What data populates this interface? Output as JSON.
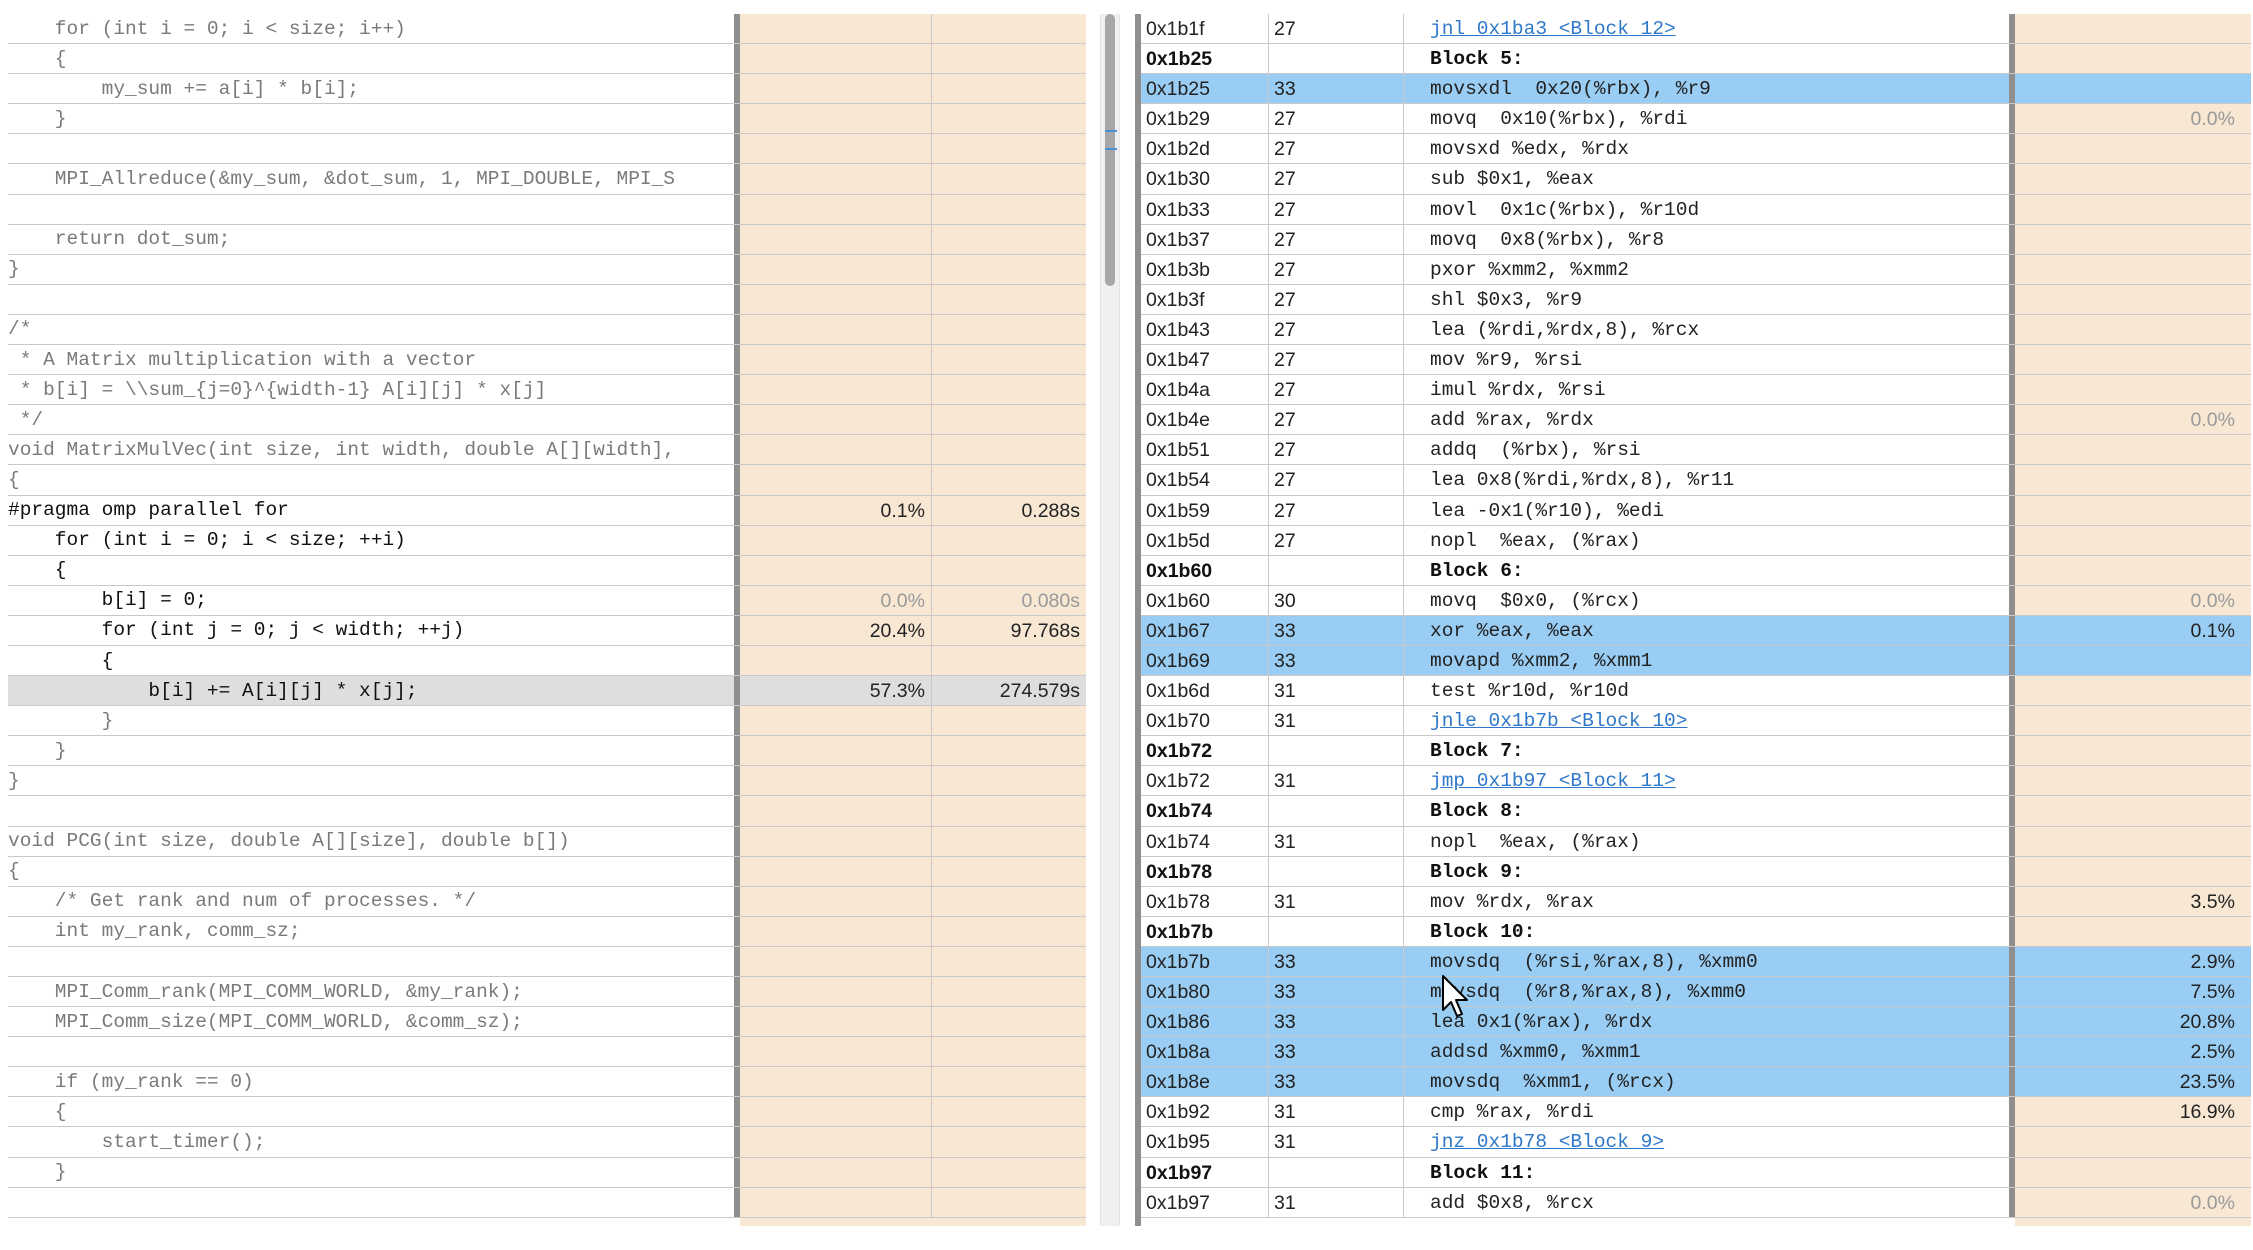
{
  "source": {
    "rows": [
      {
        "code": "    for (int i = 0; i < size; i++)",
        "pct": "",
        "time": ""
      },
      {
        "code": "    {",
        "pct": "",
        "time": ""
      },
      {
        "code": "        my_sum += a[i] * b[i];",
        "pct": "",
        "time": ""
      },
      {
        "code": "    }",
        "pct": "",
        "time": ""
      },
      {
        "code": "",
        "pct": "",
        "time": ""
      },
      {
        "code": "    MPI_Allreduce(&my_sum, &dot_sum, 1, MPI_DOUBLE, MPI_S",
        "pct": "",
        "time": ""
      },
      {
        "code": "",
        "pct": "",
        "time": ""
      },
      {
        "code": "    return dot_sum;",
        "pct": "",
        "time": ""
      },
      {
        "code": "}",
        "pct": "",
        "time": ""
      },
      {
        "code": "",
        "pct": "",
        "time": ""
      },
      {
        "code": "/*",
        "pct": "",
        "time": ""
      },
      {
        "code": " * A Matrix multiplication with a vector",
        "pct": "",
        "time": ""
      },
      {
        "code": " * b[i] = \\\\sum_{j=0}^{width-1} A[i][j] * x[j]",
        "pct": "",
        "time": ""
      },
      {
        "code": " */",
        "pct": "",
        "time": ""
      },
      {
        "code": "void MatrixMulVec(int size, int width, double A[][width],",
        "pct": "",
        "time": ""
      },
      {
        "code": "{",
        "pct": "",
        "time": ""
      },
      {
        "code": "#pragma omp parallel for",
        "pct": "0.1%",
        "time": "0.288s",
        "hot": true
      },
      {
        "code": "    for (int i = 0; i < size; ++i)",
        "pct": "",
        "time": "",
        "hot": true
      },
      {
        "code": "    {",
        "pct": "",
        "time": "",
        "hot": true
      },
      {
        "code": "        b[i] = 0;",
        "pct": "0.0%",
        "time": "0.080s",
        "hot": true,
        "muted": true
      },
      {
        "code": "        for (int j = 0; j < width; ++j)",
        "pct": "20.4%",
        "time": "97.768s",
        "hot": true
      },
      {
        "code": "        {",
        "pct": "",
        "time": "",
        "hot": true
      },
      {
        "code": "            b[i] += A[i][j] * x[j];",
        "pct": "57.3%",
        "time": "274.579s",
        "hot": true,
        "highlight": true
      },
      {
        "code": "        }",
        "pct": "",
        "time": ""
      },
      {
        "code": "    }",
        "pct": "",
        "time": ""
      },
      {
        "code": "}",
        "pct": "",
        "time": ""
      },
      {
        "code": "",
        "pct": "",
        "time": ""
      },
      {
        "code": "void PCG(int size, double A[][size], double b[])",
        "pct": "",
        "time": ""
      },
      {
        "code": "{",
        "pct": "",
        "time": ""
      },
      {
        "code": "    /* Get rank and num of processes. */",
        "pct": "",
        "time": ""
      },
      {
        "code": "    int my_rank, comm_sz;",
        "pct": "",
        "time": ""
      },
      {
        "code": "",
        "pct": "",
        "time": ""
      },
      {
        "code": "    MPI_Comm_rank(MPI_COMM_WORLD, &my_rank);",
        "pct": "",
        "time": ""
      },
      {
        "code": "    MPI_Comm_size(MPI_COMM_WORLD, &comm_sz);",
        "pct": "",
        "time": ""
      },
      {
        "code": "",
        "pct": "",
        "time": ""
      },
      {
        "code": "    if (my_rank == 0)",
        "pct": "",
        "time": ""
      },
      {
        "code": "    {",
        "pct": "",
        "time": ""
      },
      {
        "code": "        start_timer();",
        "pct": "",
        "time": ""
      },
      {
        "code": "    }",
        "pct": "",
        "time": ""
      },
      {
        "code": "",
        "pct": "",
        "time": ""
      }
    ]
  },
  "assembly": {
    "rows": [
      {
        "addr": "0x1b1f",
        "line": "27",
        "instr": "jnl 0x1ba3 <Block 12>",
        "pct": "",
        "link": true
      },
      {
        "addr": "0x1b25",
        "line": "",
        "instr": "Block 5:",
        "pct": "",
        "block": true
      },
      {
        "addr": "0x1b25",
        "line": "33",
        "instr": "movsxdl  0x20(%rbx), %r9",
        "pct": "",
        "selected": true
      },
      {
        "addr": "0x1b29",
        "line": "27",
        "instr": "movq  0x10(%rbx), %rdi",
        "pct": "0.0%",
        "muted": true
      },
      {
        "addr": "0x1b2d",
        "line": "27",
        "instr": "movsxd %edx, %rdx",
        "pct": ""
      },
      {
        "addr": "0x1b30",
        "line": "27",
        "instr": "sub $0x1, %eax",
        "pct": ""
      },
      {
        "addr": "0x1b33",
        "line": "27",
        "instr": "movl  0x1c(%rbx), %r10d",
        "pct": ""
      },
      {
        "addr": "0x1b37",
        "line": "27",
        "instr": "movq  0x8(%rbx), %r8",
        "pct": ""
      },
      {
        "addr": "0x1b3b",
        "line": "27",
        "instr": "pxor %xmm2, %xmm2",
        "pct": ""
      },
      {
        "addr": "0x1b3f",
        "line": "27",
        "instr": "shl $0x3, %r9",
        "pct": ""
      },
      {
        "addr": "0x1b43",
        "line": "27",
        "instr": "lea (%rdi,%rdx,8), %rcx",
        "pct": ""
      },
      {
        "addr": "0x1b47",
        "line": "27",
        "instr": "mov %r9, %rsi",
        "pct": ""
      },
      {
        "addr": "0x1b4a",
        "line": "27",
        "instr": "imul %rdx, %rsi",
        "pct": ""
      },
      {
        "addr": "0x1b4e",
        "line": "27",
        "instr": "add %rax, %rdx",
        "pct": "0.0%",
        "muted": true
      },
      {
        "addr": "0x1b51",
        "line": "27",
        "instr": "addq  (%rbx), %rsi",
        "pct": ""
      },
      {
        "addr": "0x1b54",
        "line": "27",
        "instr": "lea 0x8(%rdi,%rdx,8), %r11",
        "pct": ""
      },
      {
        "addr": "0x1b59",
        "line": "27",
        "instr": "lea -0x1(%r10), %edi",
        "pct": ""
      },
      {
        "addr": "0x1b5d",
        "line": "27",
        "instr": "nopl  %eax, (%rax)",
        "pct": ""
      },
      {
        "addr": "0x1b60",
        "line": "",
        "instr": "Block 6:",
        "pct": "",
        "block": true
      },
      {
        "addr": "0x1b60",
        "line": "30",
        "instr": "movq  $0x0, (%rcx)",
        "pct": "0.0%",
        "muted": true
      },
      {
        "addr": "0x1b67",
        "line": "33",
        "instr": "xor %eax, %eax",
        "pct": "0.1%",
        "selected": true
      },
      {
        "addr": "0x1b69",
        "line": "33",
        "instr": "movapd %xmm2, %xmm1",
        "pct": "",
        "selected": true
      },
      {
        "addr": "0x1b6d",
        "line": "31",
        "instr": "test %r10d, %r10d",
        "pct": ""
      },
      {
        "addr": "0x1b70",
        "line": "31",
        "instr": "jnle 0x1b7b <Block 10>",
        "pct": "",
        "link": true
      },
      {
        "addr": "0x1b72",
        "line": "",
        "instr": "Block 7:",
        "pct": "",
        "block": true
      },
      {
        "addr": "0x1b72",
        "line": "31",
        "instr": "jmp 0x1b97 <Block 11>",
        "pct": "",
        "link": true
      },
      {
        "addr": "0x1b74",
        "line": "",
        "instr": "Block 8:",
        "pct": "",
        "block": true
      },
      {
        "addr": "0x1b74",
        "line": "31",
        "instr": "nopl  %eax, (%rax)",
        "pct": ""
      },
      {
        "addr": "0x1b78",
        "line": "",
        "instr": "Block 9:",
        "pct": "",
        "block": true
      },
      {
        "addr": "0x1b78",
        "line": "31",
        "instr": "mov %rdx, %rax",
        "pct": "3.5%"
      },
      {
        "addr": "0x1b7b",
        "line": "",
        "instr": "Block 10:",
        "pct": "",
        "block": true
      },
      {
        "addr": "0x1b7b",
        "line": "33",
        "instr": "movsdq  (%rsi,%rax,8), %xmm0",
        "pct": "2.9%",
        "selected": true
      },
      {
        "addr": "0x1b80",
        "line": "33",
        "instr": "movsdq  (%r8,%rax,8), %xmm0",
        "pct": "7.5%",
        "selected": true
      },
      {
        "addr": "0x1b86",
        "line": "33",
        "instr": "lea 0x1(%rax), %rdx",
        "pct": "20.8%",
        "selected": true
      },
      {
        "addr": "0x1b8a",
        "line": "33",
        "instr": "addsd %xmm0, %xmm1",
        "pct": "2.5%",
        "selected": true
      },
      {
        "addr": "0x1b8e",
        "line": "33",
        "instr": "movsdq  %xmm1, (%rcx)",
        "pct": "23.5%",
        "selected": true
      },
      {
        "addr": "0x1b92",
        "line": "31",
        "instr": "cmp %rax, %rdi",
        "pct": "16.9%"
      },
      {
        "addr": "0x1b95",
        "line": "31",
        "instr": "jnz 0x1b78 <Block 9>",
        "pct": "",
        "link": true
      },
      {
        "addr": "0x1b97",
        "line": "",
        "instr": "Block 11:",
        "pct": "",
        "block": true
      },
      {
        "addr": "0x1b97",
        "line": "31",
        "instr": "add $0x8, %rcx",
        "pct": "0.0%",
        "muted": true
      }
    ]
  }
}
